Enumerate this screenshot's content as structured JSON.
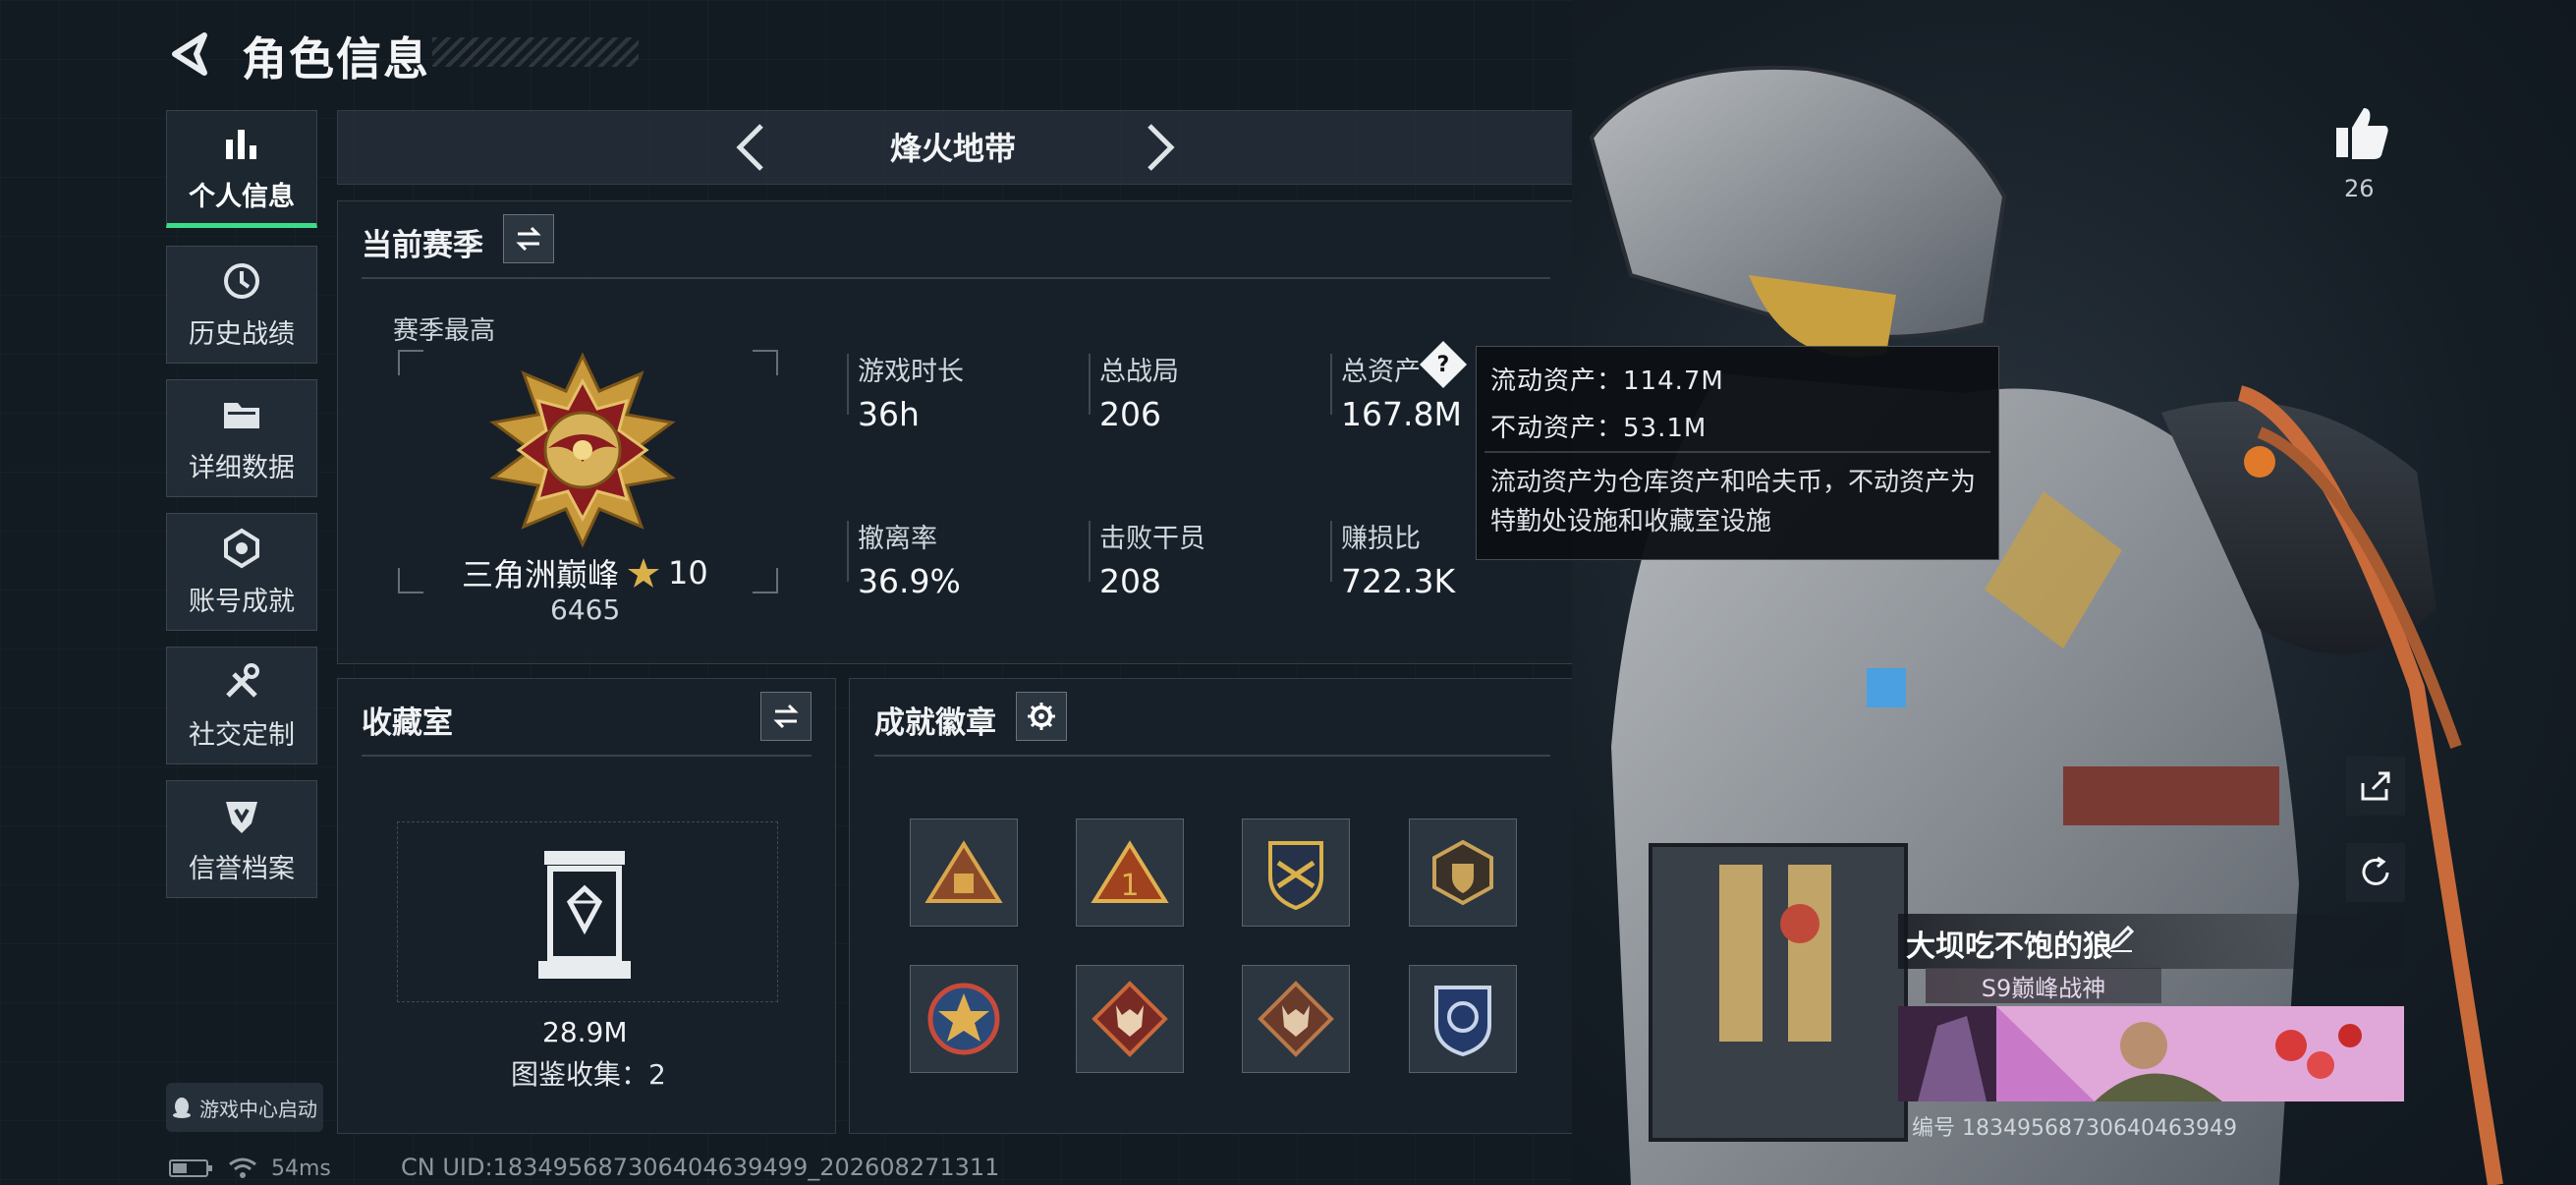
{
  "header": {
    "title": "角色信息",
    "back_icon": "back-arrow-icon"
  },
  "nav": {
    "items": [
      {
        "label": "个人信息",
        "icon": "bar-chart-icon",
        "active": true
      },
      {
        "label": "历史战绩",
        "icon": "clock-icon",
        "active": false
      },
      {
        "label": "详细数据",
        "icon": "folder-icon",
        "active": false
      },
      {
        "label": "账号成就",
        "icon": "achievement-icon",
        "active": false
      },
      {
        "label": "社交定制",
        "icon": "tools-icon",
        "active": false
      },
      {
        "label": "信誉档案",
        "icon": "shield-icon",
        "active": false
      }
    ],
    "launch_label": "游戏中心启动"
  },
  "mode": {
    "name": "烽火地带"
  },
  "season": {
    "title": "当前赛季",
    "peak_label": "赛季最高",
    "rank_name": "三角洲巅峰",
    "rank_stars": "10",
    "rank_points": "6465",
    "stats": [
      {
        "label": "游戏时长",
        "value": "36h"
      },
      {
        "label": "总战局",
        "value": "206"
      },
      {
        "label": "总资产",
        "value": "167.8M"
      },
      {
        "label": "撤离率",
        "value": "36.9%"
      },
      {
        "label": "击败干员",
        "value": "208"
      },
      {
        "label": "赚损比",
        "value": "722.3K"
      }
    ]
  },
  "tooltip": {
    "liquid": "流动资产：114.7M",
    "fixed": "不动资产：53.1M",
    "note": "流动资产为仓库资产和哈夫币，不动资产为特勤处设施和收藏室设施"
  },
  "collection": {
    "title": "收藏室",
    "value": "28.9M",
    "atlas": "图鉴收集：2"
  },
  "achievements": {
    "title": "成就徽章",
    "badges": [
      "badge-pyramid",
      "badge-rank-one",
      "badge-crest",
      "badge-hex-shield",
      "badge-star-medal",
      "badge-wolf",
      "badge-wolf-bronze",
      "badge-blue-shield"
    ]
  },
  "player": {
    "likes": "26",
    "name": "大坝吃不饱的狼",
    "title": "S9巅峰战神",
    "id_line": "编号 18349568730640463949"
  },
  "status": {
    "ping": "54ms",
    "uid": "CN UID:18349568730640463949​9_202608271311"
  }
}
